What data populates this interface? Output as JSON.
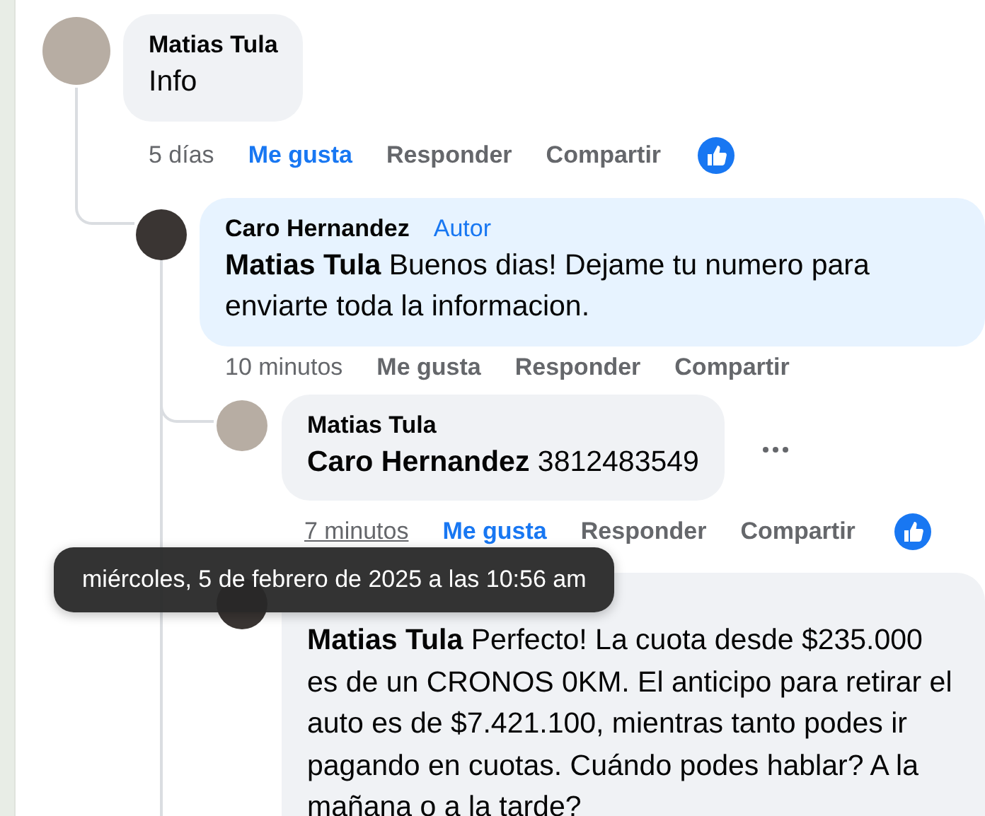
{
  "comments": [
    {
      "author": "Matias Tula",
      "text": "Info",
      "time": "5 días",
      "time_hovered": false,
      "like_label": "Me gusta",
      "liked": true,
      "reply_label": "Responder",
      "share_label": "Compartir",
      "reacted": true,
      "children": [
        {
          "author": "Caro Hernandez",
          "badge": "Autor",
          "text": "**Matias Tula** Buenos dias! Dejame tu numero para enviarte toda la informacion.",
          "time": "10 minutos",
          "time_hovered": false,
          "like_label": "Me gusta",
          "liked": false,
          "reply_label": "Responder",
          "share_label": "Compartir",
          "reacted": false,
          "children": [
            {
              "author": "Matias Tula",
              "text": "**Caro Hernandez** 3812483549",
              "more_menu": true,
              "time": "7 minutos",
              "time_hovered": true,
              "like_label": "Me gusta",
              "liked": true,
              "reply_label": "Responder",
              "share_label": "Compartir",
              "reacted": true
            },
            {
              "text": "**Matias Tula** Perfecto! La cuota desde $235.000 es de un CRONOS 0KM. El anticipo para retirar el auto es de $7.421.100, mientras tanto podes ir pagando en cuotas. Cuándo podes hablar? A la mañana o a la tarde?"
            }
          ]
        }
      ]
    }
  ],
  "tooltip": {
    "text": "miércoles, 5 de febrero de 2025 a las 10:56 am"
  }
}
